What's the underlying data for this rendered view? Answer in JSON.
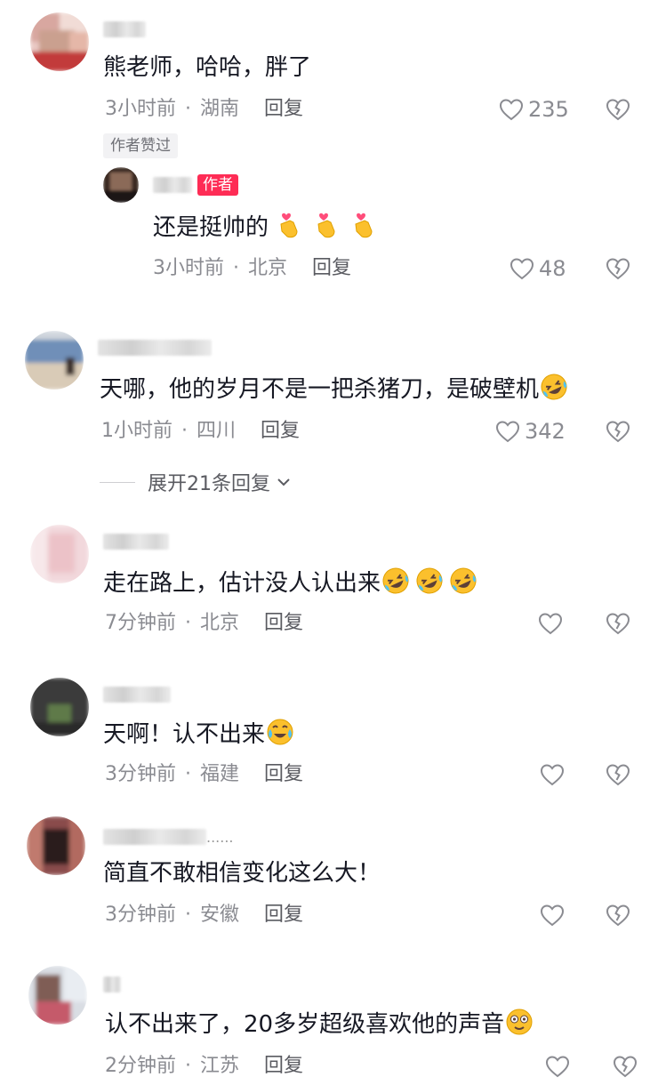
{
  "comments": [
    {
      "text": "熊老师，哈哈，胖了",
      "time": "3小时前",
      "location": "湖南",
      "reply": "回复",
      "likes": "235",
      "author_liked": "作者赞过",
      "author_reply": {
        "badge": "作者",
        "text": "还是挺帅的",
        "emojis": [
          "finger-heart-emoji",
          "finger-heart-emoji",
          "finger-heart-emoji"
        ],
        "time": "3小时前",
        "location": "北京",
        "reply": "回复",
        "likes": "48"
      }
    },
    {
      "text": "天哪，他的岁月不是一把杀猪刀，是破壁机",
      "emojis": [
        "rolling-laughing-emoji"
      ],
      "time": "1小时前",
      "location": "四川",
      "reply": "回复",
      "likes": "342",
      "expand_label": "展开21条回复"
    },
    {
      "text": "走在路上，估计没人认出来",
      "emojis": [
        "rolling-laughing-emoji",
        "rolling-laughing-emoji",
        "rolling-laughing-emoji"
      ],
      "time": "7分钟前",
      "location": "北京",
      "reply": "回复"
    },
    {
      "text": "天啊！认不出来",
      "emojis": [
        "crying-laughing-emoji"
      ],
      "time": "3分钟前",
      "location": "福建",
      "reply": "回复"
    },
    {
      "name_suffix": "......",
      "text": "简直不敢相信变化这么大！",
      "time": "3分钟前",
      "location": "安徽",
      "reply": "回复"
    },
    {
      "text": "认不出来了，20多岁超级喜欢他的声音",
      "emojis": [
        "dizzy-face-emoji"
      ],
      "time": "2分钟前",
      "location": "江苏",
      "reply": "回复"
    }
  ],
  "colors": {
    "text": "#161823",
    "meta": "#8a8b91",
    "author_badge": "#fe2c55"
  }
}
